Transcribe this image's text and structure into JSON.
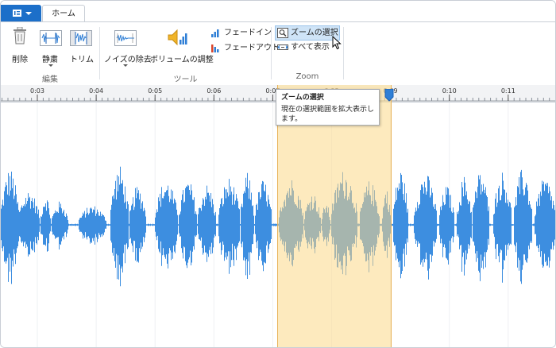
{
  "tabs": {
    "app_menu_icon": "app-menu-icon",
    "home_label": "ホーム"
  },
  "ribbon": {
    "edit_group": {
      "label": "編集",
      "buttons": [
        {
          "id": "delete",
          "label": "削除",
          "icon": "trash-icon"
        },
        {
          "id": "silence",
          "label": "静粛",
          "icon": "silence-icon"
        },
        {
          "id": "trim",
          "label": "トリム",
          "icon": "trim-icon"
        }
      ]
    },
    "tools_group": {
      "label": "ツール",
      "noise_label": "ノイズの除去",
      "volume_label": "ボリュームの調整",
      "fade_in_label": "フェードイン",
      "fade_out_label": "フェードアウト"
    },
    "zoom_group": {
      "label": "Zoom",
      "zoom_select_label": "ズームの選択",
      "show_all_label": "すべて表示"
    }
  },
  "timeline": {
    "ticks": [
      "0:03",
      "0:04",
      "0:05",
      "0:06",
      "0:07",
      "0:08",
      "0:09",
      "0:10",
      "0:11"
    ],
    "selection": {
      "start": "0:07.1",
      "end": "0:09.0"
    }
  },
  "tooltip": {
    "title": "ズームの選択",
    "body": "現在の選択範囲を拡大表示します。"
  },
  "colors": {
    "accent": "#1c6fc9",
    "waveform": "#3d8ee0",
    "waveform_selected": "#1b73d4",
    "selection_fill": "#fbe0a6"
  }
}
